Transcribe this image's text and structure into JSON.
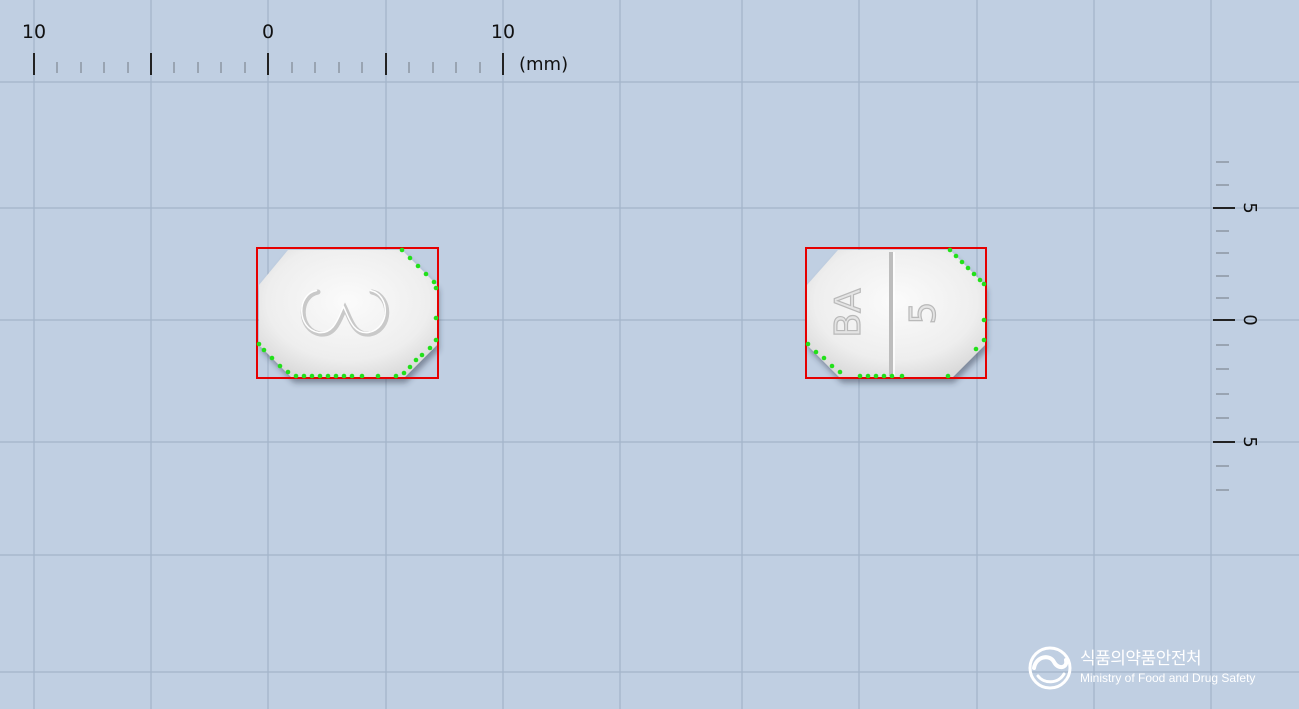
{
  "ruler_top": {
    "labels": [
      "10",
      "0",
      "10"
    ],
    "unit": "(mm)"
  },
  "ruler_right": {
    "labels": [
      "5",
      "0",
      "5"
    ]
  },
  "tablets": [
    {
      "imprint": "Ꮚ"
    },
    {
      "imprint_top": "BA",
      "imprint_bottom": "5"
    }
  ],
  "logo": {
    "korean": "식품의약품안전처",
    "english": "Ministry of Food and Drug Safety",
    "icon": "mfds-emblem-icon"
  },
  "colors": {
    "background": "#c0cfe2",
    "grid": "#a3b4c9",
    "bounding_box": "#e60000",
    "contour_points": "#22e01a",
    "tablet": "#f2f2f2"
  }
}
